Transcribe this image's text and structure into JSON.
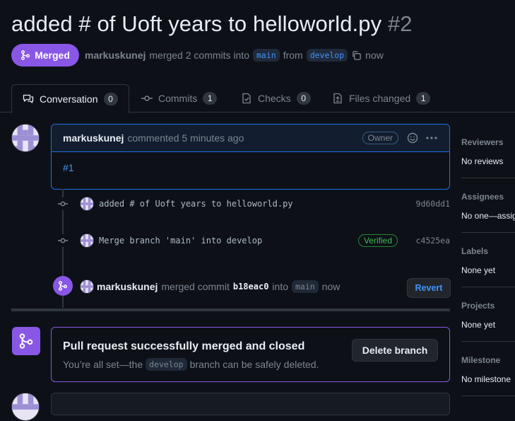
{
  "pr": {
    "title": "added # of Uoft years to helloworld.py",
    "number": "#2",
    "state_label": "Merged",
    "author": "markuskunej",
    "merged_text": "merged 2 commits into",
    "base_branch": "main",
    "from_text": "from",
    "head_branch": "develop",
    "time": "now"
  },
  "tabs": [
    {
      "label": "Conversation",
      "count": "0",
      "icon": "comment-discussion-icon"
    },
    {
      "label": "Commits",
      "count": "1",
      "icon": "git-commit-icon"
    },
    {
      "label": "Checks",
      "count": "0",
      "icon": "checklist-icon"
    },
    {
      "label": "Files changed",
      "count": "1",
      "icon": "file-diff-icon"
    }
  ],
  "comment": {
    "author": "markuskunej",
    "meta": "commented 5 minutes ago",
    "role_badge": "Owner",
    "body": "#1"
  },
  "commits": [
    {
      "message": "added # of Uoft years to helloworld.py",
      "sha": "9d60dd1",
      "verified": ""
    },
    {
      "message": "Merge branch 'main' into develop",
      "sha": "c4525ea",
      "verified": "Verified"
    }
  ],
  "merge_event": {
    "author": "markuskunej",
    "text": "merged commit",
    "sha": "b18eac0",
    "into_text": "into",
    "branch": "main",
    "time": "now",
    "revert_label": "Revert"
  },
  "merged_box": {
    "title": "Pull request successfully merged and closed",
    "desc_prefix": "You’re all set—the",
    "branch": "develop",
    "desc_suffix": "branch can be safely deleted.",
    "delete_label": "Delete branch"
  },
  "sidebar": [
    {
      "title": "Reviewers",
      "value": "No reviews"
    },
    {
      "title": "Assignees",
      "value": "No one—assign yourself"
    },
    {
      "title": "Labels",
      "value": "None yet"
    },
    {
      "title": "Projects",
      "value": "None yet"
    },
    {
      "title": "Milestone",
      "value": "No milestone"
    }
  ],
  "colors": {
    "merged_purple": "#8957e5",
    "link_blue": "#4493f8",
    "verified_green": "#3fb950",
    "background": "#0d1117"
  }
}
